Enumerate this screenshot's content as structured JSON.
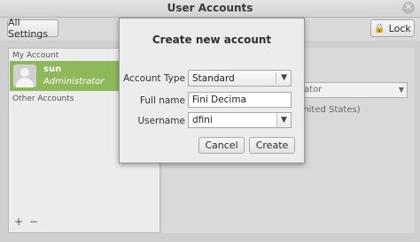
{
  "window": {
    "title": "User Accounts"
  },
  "toolbar": {
    "all_settings_label": "All Settings",
    "lock_label": "Lock"
  },
  "sidebar": {
    "my_account_label": "My Account",
    "other_accounts_label": "Other Accounts",
    "users": [
      {
        "name": "sun",
        "role": "Administrator"
      }
    ],
    "add_symbol": "+",
    "remove_symbol": "−"
  },
  "background_panel": {
    "account_type_partial": "rator",
    "language_partial": "United States)"
  },
  "dialog": {
    "title": "Create new account",
    "account_type_label": "Account Type",
    "account_type_value": "Standard",
    "full_name_label": "Full name",
    "full_name_value": "Fini Decima",
    "username_label": "Username",
    "username_value": "dfini",
    "cancel_label": "Cancel",
    "create_label": "Create"
  },
  "icons": {
    "lock": "lock-icon",
    "close": "close-icon",
    "avatar": "user-avatar-icon",
    "dropdown": "chevron-down-icon"
  },
  "colors": {
    "selected_row": "#8fb85a",
    "dialog_bg": "#ececec"
  }
}
